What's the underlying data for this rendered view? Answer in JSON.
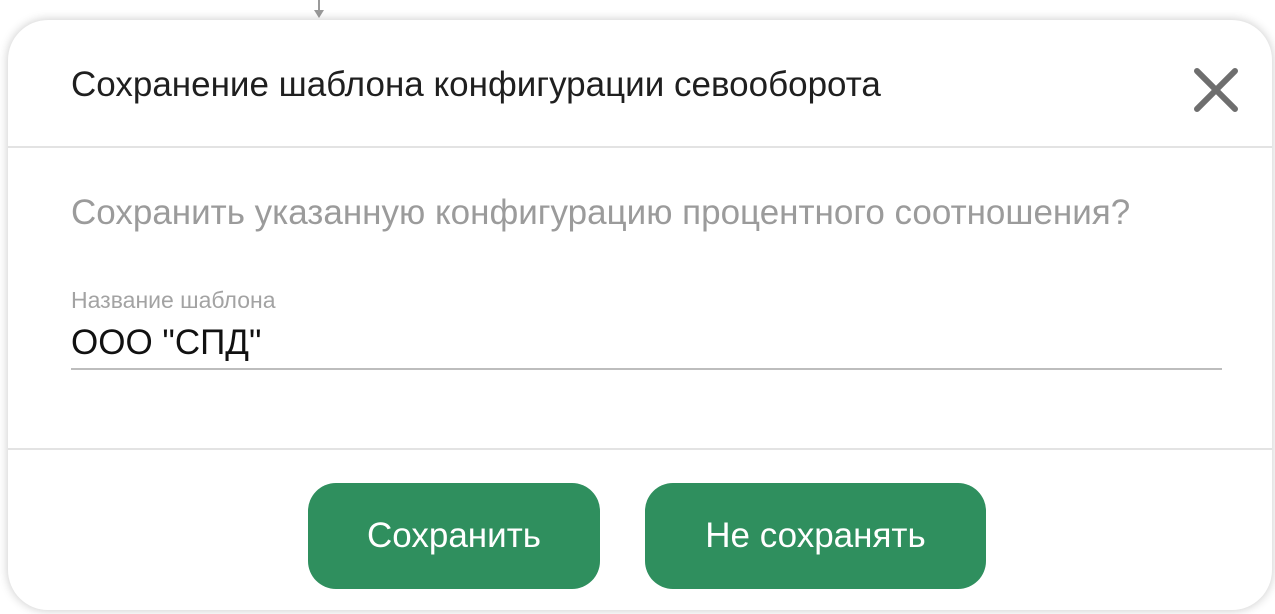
{
  "colors": {
    "accent": "#2f8f5e",
    "title_text": "#1f1f1f",
    "muted_text": "#9b9b9b",
    "divider": "#e3e3e3"
  },
  "icons": {
    "close": "close-icon",
    "pointer": "arrow-down-icon"
  },
  "dialog": {
    "title": "Сохранение шаблона конфигурации севооборота",
    "prompt": "Сохранить указанную конфигурацию процентного соотношения?",
    "field": {
      "label": "Название шаблона",
      "value": "ООО \"СПД\""
    },
    "buttons": {
      "save": "Сохранить",
      "dont_save": "Не сохранять"
    }
  }
}
